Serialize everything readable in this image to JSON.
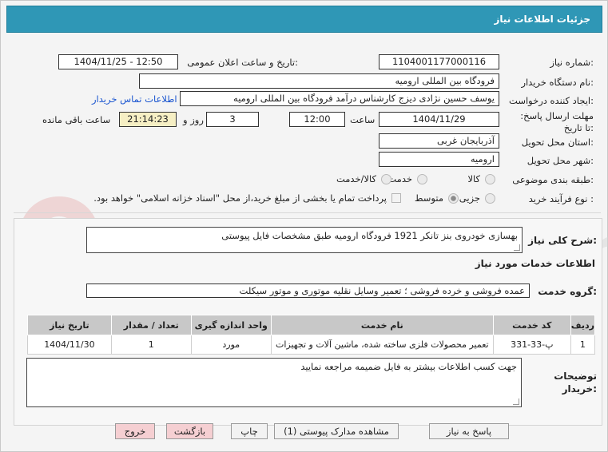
{
  "header": {
    "title": "جزئیات اطلاعات نیاز"
  },
  "watermark": {
    "text": "AriaTender.net"
  },
  "form": {
    "need_number_label": "شماره نیاز:",
    "need_number": "1104001177000116",
    "announce_label": "تاریخ و ساعت اعلان عمومی:",
    "announce_value": "1404/11/25 - 12:50",
    "buyer_org_label": "نام دستگاه خریدار:",
    "buyer_org": "فرودگاه بین المللی ارومیه",
    "creator_label": "ایجاد کننده درخواست:",
    "creator": "یوسف حسین نژادی دیزج کارشناس درآمد فرودگاه بین المللی ارومیه",
    "contact_link": "اطلاعات تماس خریدار",
    "deadline_label": "مهلت ارسال پاسخ: تا تاریخ:",
    "deadline_date": "1404/11/29",
    "time_label": "ساعت",
    "deadline_time": "12:00",
    "days_label": "روز و",
    "days_value": "3",
    "remaining_time": "21:14:23",
    "remaining_label": "ساعت باقی مانده",
    "province_label": "استان محل تحویل:",
    "province": "آذربایجان غربی",
    "city_label": "شهر محل تحویل:",
    "city": "ارومیه",
    "category_label": "طبقه بندی موضوعی:",
    "category_options": [
      "کالا",
      "خدمت",
      "کالا/خدمت"
    ],
    "process_label": "نوع فرآیند خرید :",
    "process_options": [
      "جزیی",
      "متوسط"
    ],
    "payment_note": "پرداخت تمام یا بخشی از مبلغ خرید،از محل \"اسناد خزانه اسلامی\" خواهد بود."
  },
  "details": {
    "summary_label": "شرح کلی نیاز:",
    "summary": "بهسازی خودروی بنز تانکر 1921 فرودگاه ارومیه طبق مشخصات فایل پیوستی",
    "services_title": "اطلاعات خدمات مورد نیاز",
    "service_group_label": "گروه خدمت:",
    "service_group": "عمده فروشی و خرده فروشی ؛ تعمیر وسایل نقلیه موتوری و موتور سیکلت",
    "table": {
      "headers": [
        "ردیف",
        "کد خدمت",
        "نام خدمت",
        "واحد اندازه گیری",
        "تعداد / مقدار",
        "تاریخ نیاز"
      ],
      "rows": [
        [
          "1",
          "پ-33-331",
          "تعمیر محصولات فلزی ساخته شده، ماشین آلات و تجهیزات",
          "مورد",
          "1",
          "1404/11/30"
        ]
      ]
    },
    "buyer_notes_label": "توضیحات خریدار:",
    "buyer_notes": "جهت کسب اطلاعات بیشتر به فایل ضمیمه مراجعه نمایید"
  },
  "buttons": {
    "reply": "پاسخ به نیاز",
    "attachments": "مشاهده مدارک پیوستی (1)",
    "print": "چاپ",
    "back": "بازگشت",
    "exit": "خروج"
  }
}
